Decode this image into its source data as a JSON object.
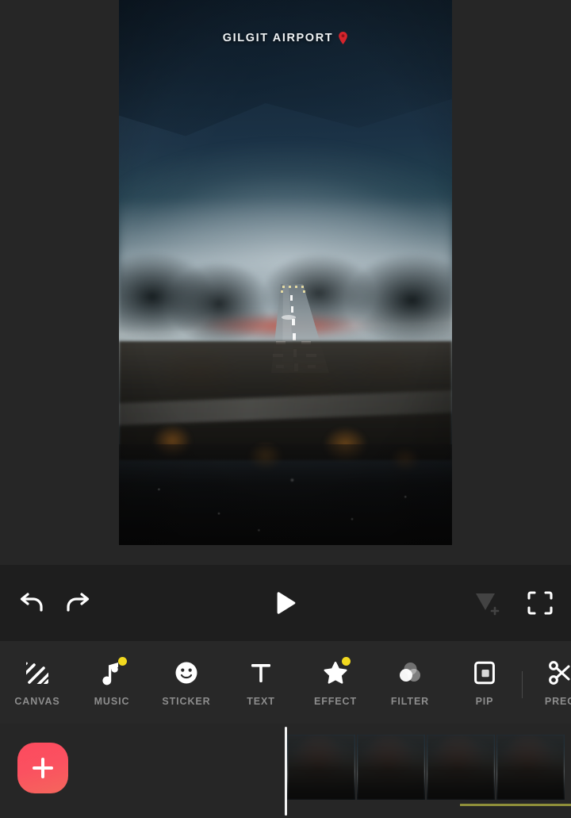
{
  "app": {
    "name": "video-editor",
    "theme_bg": "#262626",
    "accent": "#fb5160",
    "badge_color": "#f2d91f"
  },
  "preview": {
    "overlay_title": "GILGIT AIRPORT",
    "overlay_pin_icon": "location-pin-icon",
    "scene": "aerial view of Gilgit Airport runway in mountain valley haze"
  },
  "playback_bar": {
    "undo": {
      "icon": "undo-icon",
      "label": "Undo"
    },
    "redo": {
      "icon": "redo-icon",
      "label": "Redo"
    },
    "play": {
      "icon": "play-icon",
      "label": "Play"
    },
    "keyframe": {
      "icon": "add-keyframe-icon",
      "label": "Add keyframe",
      "enabled": false
    },
    "fullscreen": {
      "icon": "fullscreen-icon",
      "label": "Fullscreen"
    }
  },
  "toolbar": {
    "items": [
      {
        "label": "CANVAS",
        "icon": "canvas-hatch-icon",
        "badge": false
      },
      {
        "label": "MUSIC",
        "icon": "music-note-icon",
        "badge": true
      },
      {
        "label": "STICKER",
        "icon": "smiley-sticker-icon",
        "badge": false
      },
      {
        "label": "TEXT",
        "icon": "text-t-icon",
        "badge": false
      },
      {
        "label": "EFFECT",
        "icon": "star-effect-icon",
        "badge": true
      },
      {
        "label": "FILTER",
        "icon": "filter-circles-icon",
        "badge": false
      },
      {
        "label": "PIP",
        "icon": "picture-in-picture-icon",
        "badge": false
      },
      {
        "label": "PREC",
        "icon": "scissors-precut-icon",
        "badge": false
      }
    ]
  },
  "timeline": {
    "add_button": {
      "icon": "plus-icon",
      "label": "Add media"
    },
    "playhead": {
      "label": "Playhead"
    },
    "clip": {
      "label": "Video clip",
      "thumbnail_count": 4
    },
    "audio_track": {
      "label": "Audio track",
      "color": "#8f8f3a"
    }
  }
}
